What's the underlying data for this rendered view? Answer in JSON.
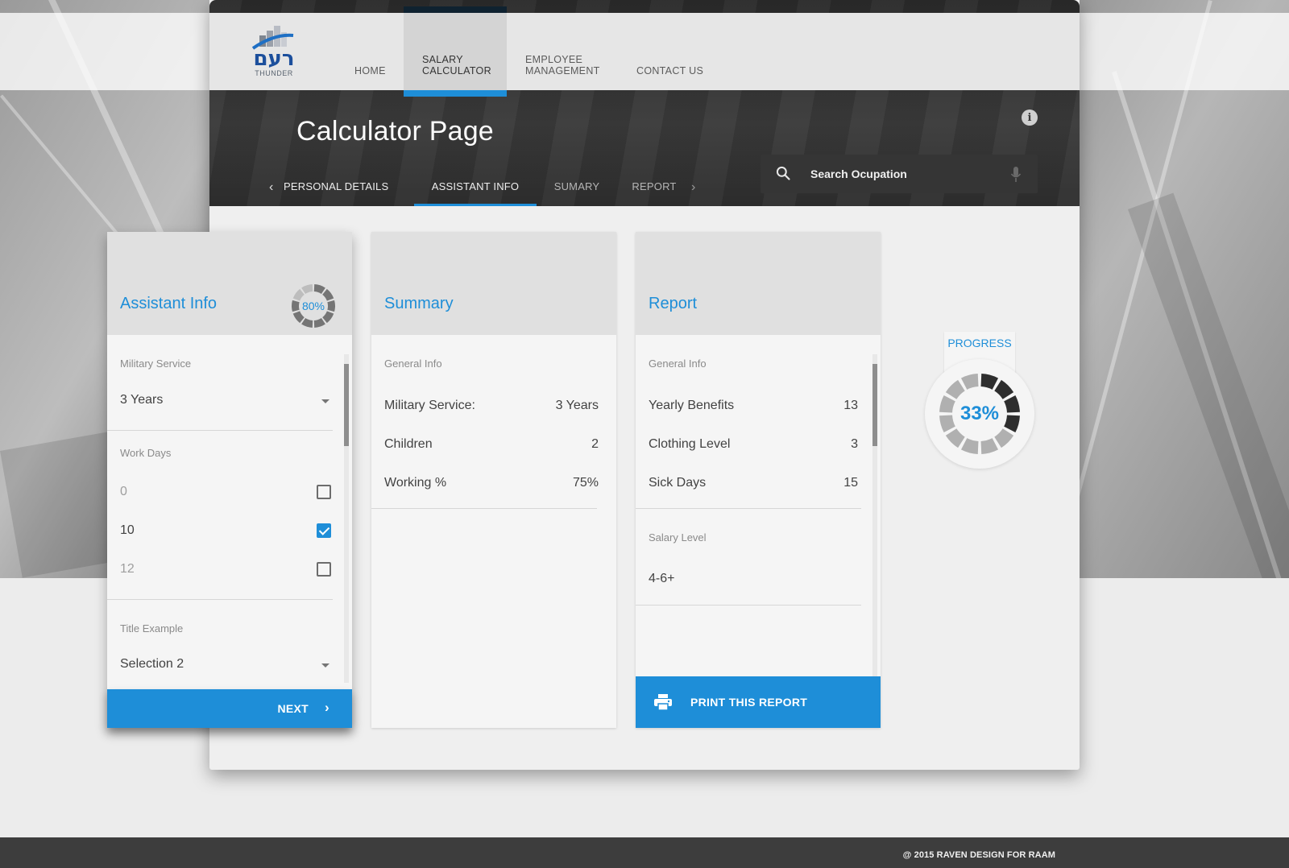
{
  "brand": {
    "logo_text": "רעם",
    "logo_sub": "THUNDER"
  },
  "nav": {
    "items": [
      {
        "line1": "HOME",
        "line2": ""
      },
      {
        "line1": "SALARY",
        "line2": "CALCULATOR"
      },
      {
        "line1": "EMPLOYEE",
        "line2": "MANAGEMENT"
      },
      {
        "line1": "CONTACT US",
        "line2": ""
      }
    ],
    "active_index": 1
  },
  "header": {
    "title": "Calculator Page",
    "info_icon": "info-icon"
  },
  "tabs": {
    "items": [
      "PERSONAL DETAILS",
      "ASSISTANT INFO",
      "SUMARY",
      "REPORT"
    ],
    "active_index": 1
  },
  "search": {
    "placeholder": "Search Ocupation",
    "icon": "search-icon",
    "voice_icon": "microphone-icon"
  },
  "assistant_card": {
    "title": "Assistant Info",
    "progress_label": "80%",
    "progress_value": 0.8,
    "military_label": "Military Service",
    "military_value": "3 Years",
    "work_days_label": "Work Days",
    "work_days": [
      {
        "label": "0",
        "checked": false
      },
      {
        "label": "10",
        "checked": true
      },
      {
        "label": "12",
        "checked": false
      }
    ],
    "title_example_label": "Title Example",
    "title_example_value": "Selection 2",
    "next_label": "NEXT"
  },
  "summary_card": {
    "title": "Summary",
    "section_label": "General Info",
    "rows": [
      {
        "label": "Military Service:",
        "value": "3 Years"
      },
      {
        "label": "Children",
        "value": "2"
      },
      {
        "label": "Working %",
        "value": "75%"
      }
    ]
  },
  "report_card": {
    "title": "Report",
    "section_label": "General Info",
    "rows": [
      {
        "label": "Yearly Benefits",
        "value": "13"
      },
      {
        "label": "Clothing Level",
        "value": "3"
      },
      {
        "label": "Sick Days",
        "value": "15"
      }
    ],
    "salary_label": "Salary Level",
    "salary_value": "4-6+",
    "print_label": "PRINT THIS REPORT"
  },
  "progress": {
    "label": "PROGRESS",
    "value_label": "33%",
    "value": 0.33
  },
  "colors": {
    "accent": "#1e8ed8",
    "dark": "#2e2e2e",
    "nav_bg": "#e6e6e6"
  },
  "footer": {
    "copyright": "@  2015 RAVEN DESIGN FOR RAAM"
  }
}
